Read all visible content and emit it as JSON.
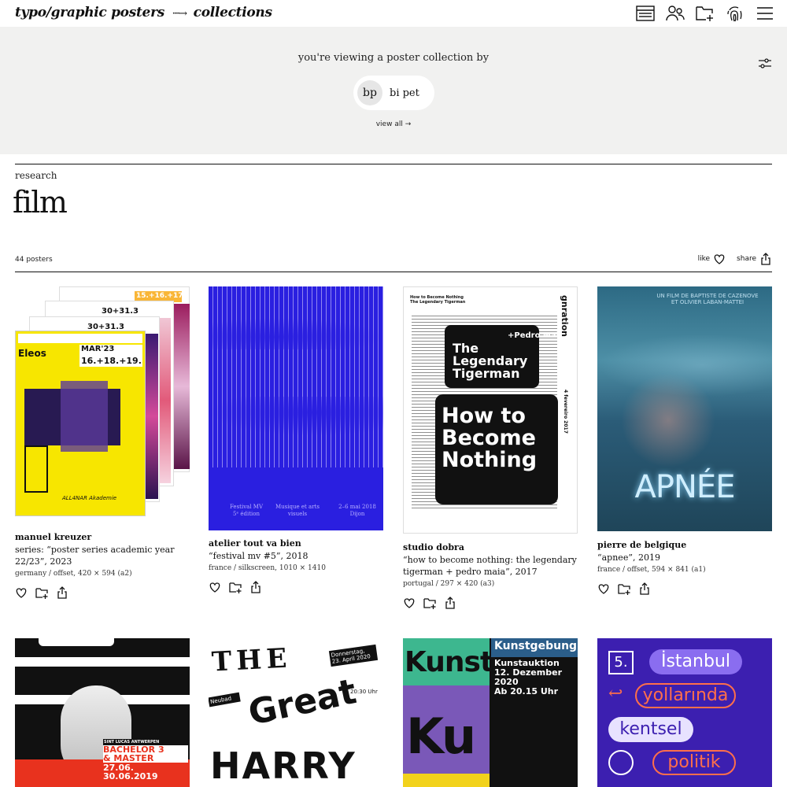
{
  "header": {
    "brand": "typo/graphic posters",
    "arrow": "····→",
    "section": "collections",
    "icons": [
      "list-icon",
      "users-icon",
      "folder-add-icon",
      "fingerprint-icon",
      "menu-icon"
    ]
  },
  "banner": {
    "intro": "you're viewing a poster collection by",
    "user": {
      "initials": "bp",
      "name": "bi pet"
    },
    "view_all": "view all →"
  },
  "collection": {
    "breadcrumb": "research",
    "title": "film",
    "count": "44 posters",
    "like_label": "like",
    "share_label": "share"
  },
  "posters": [
    {
      "designer": "manuel kreuzer",
      "title": "series: “poster series academic year 22/23”, 2023",
      "spec": "germany / offset, 420 × 594 (a2)",
      "art_text": [
        "Eleos",
        "16.+18.+19.",
        "MAR'23",
        "30+31.3",
        "15.+16.+17.",
        "ALL4NAR Akademie"
      ]
    },
    {
      "designer": "atelier tout va bien",
      "title": "“festival mv #5”, 2018",
      "spec": "france / silkscreen, 1010 × 1410",
      "art_text": [
        "Festival MV",
        "5ᵉ édition",
        "Musique et arts visuels",
        "2–6 mai 2018",
        "Dijon"
      ]
    },
    {
      "designer": "studio dobra",
      "title": "“how to become nothing: the legendary tigerman + pedro maia”, 2017",
      "spec": "portugal / 297 × 420 (a3)",
      "art_text": [
        "How to Become Nothing",
        "The Legendary Tigerman",
        "+Pedro Maia",
        "gnration",
        "4 fevereiro 2017"
      ]
    },
    {
      "designer": "pierre de belgique",
      "title": "“apnee”, 2019",
      "spec": "france / offset, 594 × 841 (a1)",
      "art_text": [
        "UN FILM DE BAPTISTE DE CAZENOVE",
        "ET OLIVIER LABAN-MATTEI",
        "APNÉE"
      ]
    },
    {
      "art_text": [
        "SINT LUCAS ANTWERPEN",
        "BACHELOR 3",
        "& MASTER",
        "EINDTENTOONSTELLING",
        "27.06.",
        "30.06.2019"
      ]
    },
    {
      "art_text": [
        "THE",
        "Great",
        "HARRY",
        "Donnerstag,",
        "23. April 2020",
        "20:30 Uhr",
        "Neubad"
      ]
    },
    {
      "art_text": [
        "Kunst",
        "Kunstgebung",
        "Kunstauktion",
        "12. Dezember 2020",
        "Ab 20.15 Uhr",
        "Ku"
      ]
    },
    {
      "art_text": [
        "5.",
        "İstanbul",
        "yollarında",
        "kentsel",
        "politik"
      ]
    }
  ],
  "colors": {
    "banner_bg": "#f1f1f0",
    "poster2_blue": "#2a1fe0",
    "poster7_green": "#3db78f",
    "poster7_purple": "#7a58b8",
    "poster8_purple": "#3c1fb0"
  }
}
